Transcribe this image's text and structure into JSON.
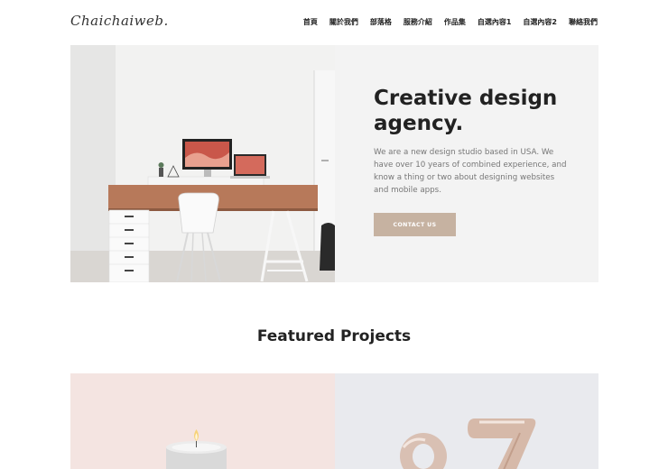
{
  "header": {
    "logo": "Chaichaiweb.",
    "nav": [
      "首頁",
      "關於我們",
      "部落格",
      "服務介紹",
      "作品集",
      "自選內容1",
      "自選內容2",
      "聯絡我們"
    ]
  },
  "hero": {
    "title": "Creative design agency.",
    "description": "We are a new design studio based in USA. We have over 10 years of combined experience, and know a thing or two about designing websites and mobile apps.",
    "button_label": "CONTACT US"
  },
  "featured": {
    "title": "Featured Projects"
  },
  "colors": {
    "accent": "#c6b2a1",
    "hero_panel": "#f3f3f3",
    "project_pink": "#f4e4e1",
    "project_grey": "#e9eaee"
  }
}
